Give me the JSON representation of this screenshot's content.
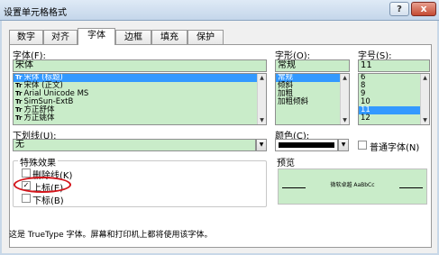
{
  "window": {
    "title": "设置单元格格式",
    "help_label": "?",
    "close_label": "x"
  },
  "tabs": [
    "数字",
    "对齐",
    "字体",
    "边框",
    "填充",
    "保护"
  ],
  "font": {
    "label": "字体(F):",
    "value": "宋体",
    "items": [
      {
        "tt": "Tr",
        "name": "宋体 (标题)",
        "selected": true
      },
      {
        "tt": "Tr",
        "name": "宋体 (正文)",
        "selected": false
      },
      {
        "tt": "Tr",
        "name": "Arial Unicode MS",
        "selected": false
      },
      {
        "tt": "Tr",
        "name": "SimSun-ExtB",
        "selected": false
      },
      {
        "tt": "Tr",
        "name": "方正舒体",
        "selected": false
      },
      {
        "tt": "Tr",
        "name": "方正姚体",
        "selected": false
      }
    ]
  },
  "style": {
    "label": "字形(O):",
    "value": "常规",
    "items": [
      {
        "name": "常规",
        "selected": true
      },
      {
        "name": "倾斜",
        "selected": false
      },
      {
        "name": "加粗",
        "selected": false
      },
      {
        "name": "加粗倾斜",
        "selected": false
      }
    ]
  },
  "size": {
    "label": "字号(S):",
    "value": "11",
    "items": [
      {
        "name": "6",
        "selected": false
      },
      {
        "name": "8",
        "selected": false
      },
      {
        "name": "9",
        "selected": false
      },
      {
        "name": "10",
        "selected": false
      },
      {
        "name": "11",
        "selected": true
      },
      {
        "name": "12",
        "selected": false
      }
    ]
  },
  "underline": {
    "label": "下划线(U):",
    "value": "无"
  },
  "color": {
    "label": "颜色(C):",
    "swatch": "#000000",
    "normal_font_label": "普通字体(N)",
    "normal_font_checked": false
  },
  "effects": {
    "label": "特殊效果",
    "strikethrough": {
      "label": "删除线(K)",
      "checked": false
    },
    "superscript": {
      "label": "上标(E)",
      "checked": true
    },
    "subscript": {
      "label": "下标(B)",
      "checked": false
    },
    "highlight_color": "#d4141a"
  },
  "preview": {
    "label": "预览",
    "text": "微软卓越 AaBbCc"
  },
  "footer": {
    "text": "这是 TrueType 字体。屏幕和打印机上都将使用该字体。"
  }
}
